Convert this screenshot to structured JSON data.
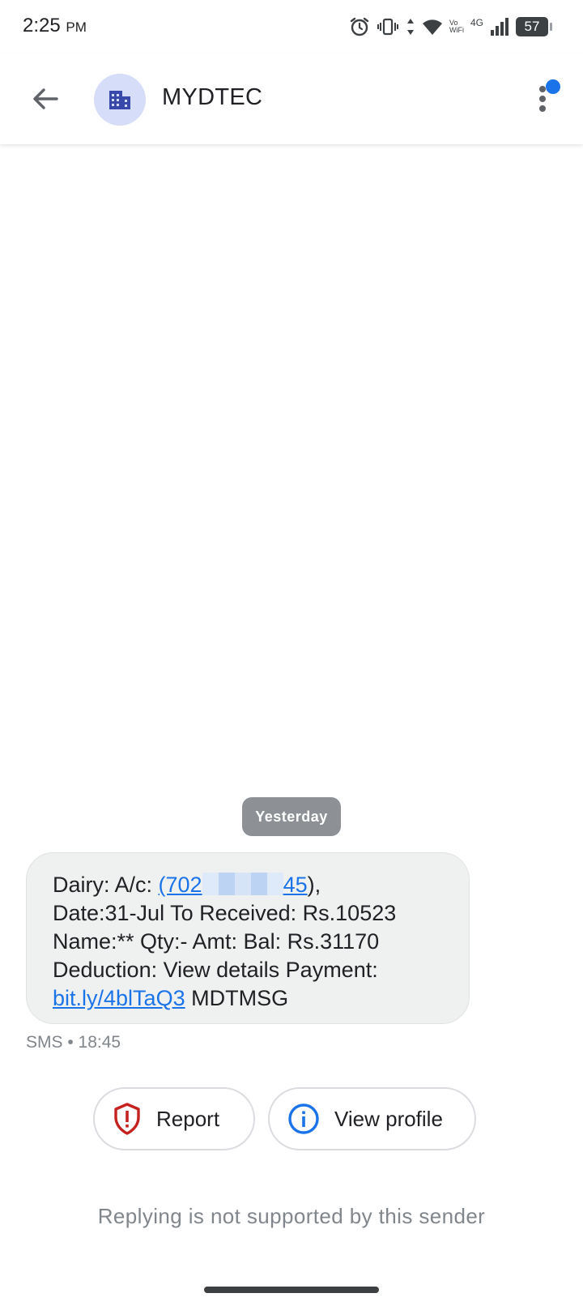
{
  "status_bar": {
    "time": "2:25",
    "ampm": "PM",
    "network_label_top": "Vo",
    "network_label_bottom": "WiFi",
    "network_type": "4G",
    "battery": "57",
    "icons": [
      "alarm-icon",
      "vibrate-icon",
      "data-arrows-icon",
      "wifi-icon",
      "signal-icon",
      "battery-icon"
    ]
  },
  "app_bar": {
    "contact_name": "MYDTEC",
    "avatar_icon": "business-icon",
    "avatar_color": "#d6ddf9",
    "unread_badge_color": "#1a73e8"
  },
  "conversation": {
    "date_chip": "Yesterday",
    "message": {
      "l1_prefix": "Dairy: A/c: ",
      "l1_link_start": "(702",
      "l1_link_end": "45",
      "l1_link_close": ")",
      "l1_suffix": ",",
      "line2": "Date:31-Jul To Received: Rs.10523",
      "line3": "Name:** Qty:- Amt: Bal: Rs.31170",
      "line4": "Deduction: View details Payment:",
      "l5_link": "bit.ly/4blTaQ3",
      "l5_suffix": " MDTMSG"
    },
    "meta": "SMS • 18:45"
  },
  "actions": {
    "report_label": "Report",
    "view_profile_label": "View profile"
  },
  "reply_note": "Replying is not supported by this sender",
  "colors": {
    "link": "#1a73e8",
    "bubble": "#eff1f1",
    "report_icon": "#c5221f",
    "info_icon": "#1a73e8"
  }
}
